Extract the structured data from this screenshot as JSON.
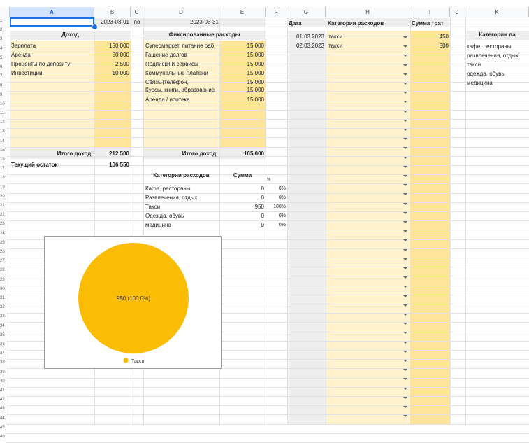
{
  "columns": [
    "A",
    "B",
    "C",
    "D",
    "E",
    "F",
    "G",
    "H",
    "I",
    "J",
    "K"
  ],
  "rows": [
    "1",
    "2",
    "3",
    "4",
    "5",
    "6",
    "7",
    "8",
    "9",
    "10",
    "11",
    "12",
    "13",
    "14",
    "15",
    "16",
    "17",
    "18",
    "19",
    "20",
    "21",
    "22",
    "23",
    "24",
    "25",
    "26",
    "27",
    "28",
    "29",
    "30",
    "31",
    "32",
    "33",
    "34",
    "35",
    "36",
    "37",
    "38",
    "39",
    "40",
    "41",
    "42",
    "43",
    "44",
    "45",
    "46"
  ],
  "period": {
    "from": "2023-03-01",
    "sep": "по",
    "to": "2023-03-31"
  },
  "income": {
    "header": "Доход",
    "items": [
      {
        "label": "Зарплата",
        "value": "150 000"
      },
      {
        "label": "Аренда",
        "value": "50 000"
      },
      {
        "label": "Проценты по депозиту",
        "value": "2 500"
      },
      {
        "label": "Инвестиции",
        "value": "10 000"
      }
    ],
    "total_label": "Итого доход:",
    "total_value": "212 500",
    "balance_label": "Текущий остаток",
    "balance_value": "106 550"
  },
  "fixed": {
    "header": "Фиксированные расходы",
    "items": [
      {
        "label": "Супермаркет, питание раб.",
        "value": "15 000"
      },
      {
        "label": "Гашение долгов",
        "value": "15 000"
      },
      {
        "label": "Подписки и сервисы",
        "value": "15 000"
      },
      {
        "label": "Коммунальные платежи",
        "value": "15 000"
      },
      {
        "label": "Связь (телефон,",
        "value": "15 000"
      },
      {
        "label": "Курсы, книги, образование",
        "value": "15 000"
      },
      {
        "label": "Аренда / ипотека",
        "value": "15 000"
      }
    ],
    "total_label": "Итого доход:",
    "total_value": "105 000"
  },
  "summary": {
    "h_category": "Категории расходов",
    "h_sum": "Сумма",
    "h_pct": "%",
    "rows": [
      {
        "label": "Кафе, рестораны",
        "sum": "0",
        "pct": "0%"
      },
      {
        "label": "Развлечения, отдых",
        "sum": "0",
        "pct": "0%"
      },
      {
        "label": "Такси",
        "sum": "950",
        "pct": "100%"
      },
      {
        "label": "Одежда, обувь",
        "sum": "0",
        "pct": "0%"
      },
      {
        "label": "медицина",
        "sum": "0",
        "pct": "0%"
      }
    ]
  },
  "log": {
    "h_date": "Дата",
    "h_category": "Категория расходов",
    "h_sum": "Сумма трат",
    "rows": [
      {
        "date": "01.03.2023",
        "category": "такси",
        "sum": "450"
      },
      {
        "date": "02.03.2023",
        "category": "такси",
        "sum": "500"
      }
    ]
  },
  "categories": {
    "header": "Категории да",
    "items": [
      "кафе, рестораны",
      "развлечения, отдых",
      "такси",
      "одежда, обувь",
      "медицина"
    ]
  },
  "chart_data": {
    "type": "pie",
    "slices": [
      {
        "label": "Такси",
        "value": 950,
        "percent": 100.0
      }
    ],
    "slice_label": "950 (100,0%)",
    "legend": [
      "Такси"
    ],
    "legend_position": "bottom",
    "colors": [
      "#fbbc04"
    ]
  },
  "colors": {
    "accent_yellow": "#fff2cc",
    "accent_yellow_dark": "#ffe599",
    "header_gray": "#eeeeee",
    "selection_blue": "#1a73e8",
    "pie": "#fbbc04"
  }
}
